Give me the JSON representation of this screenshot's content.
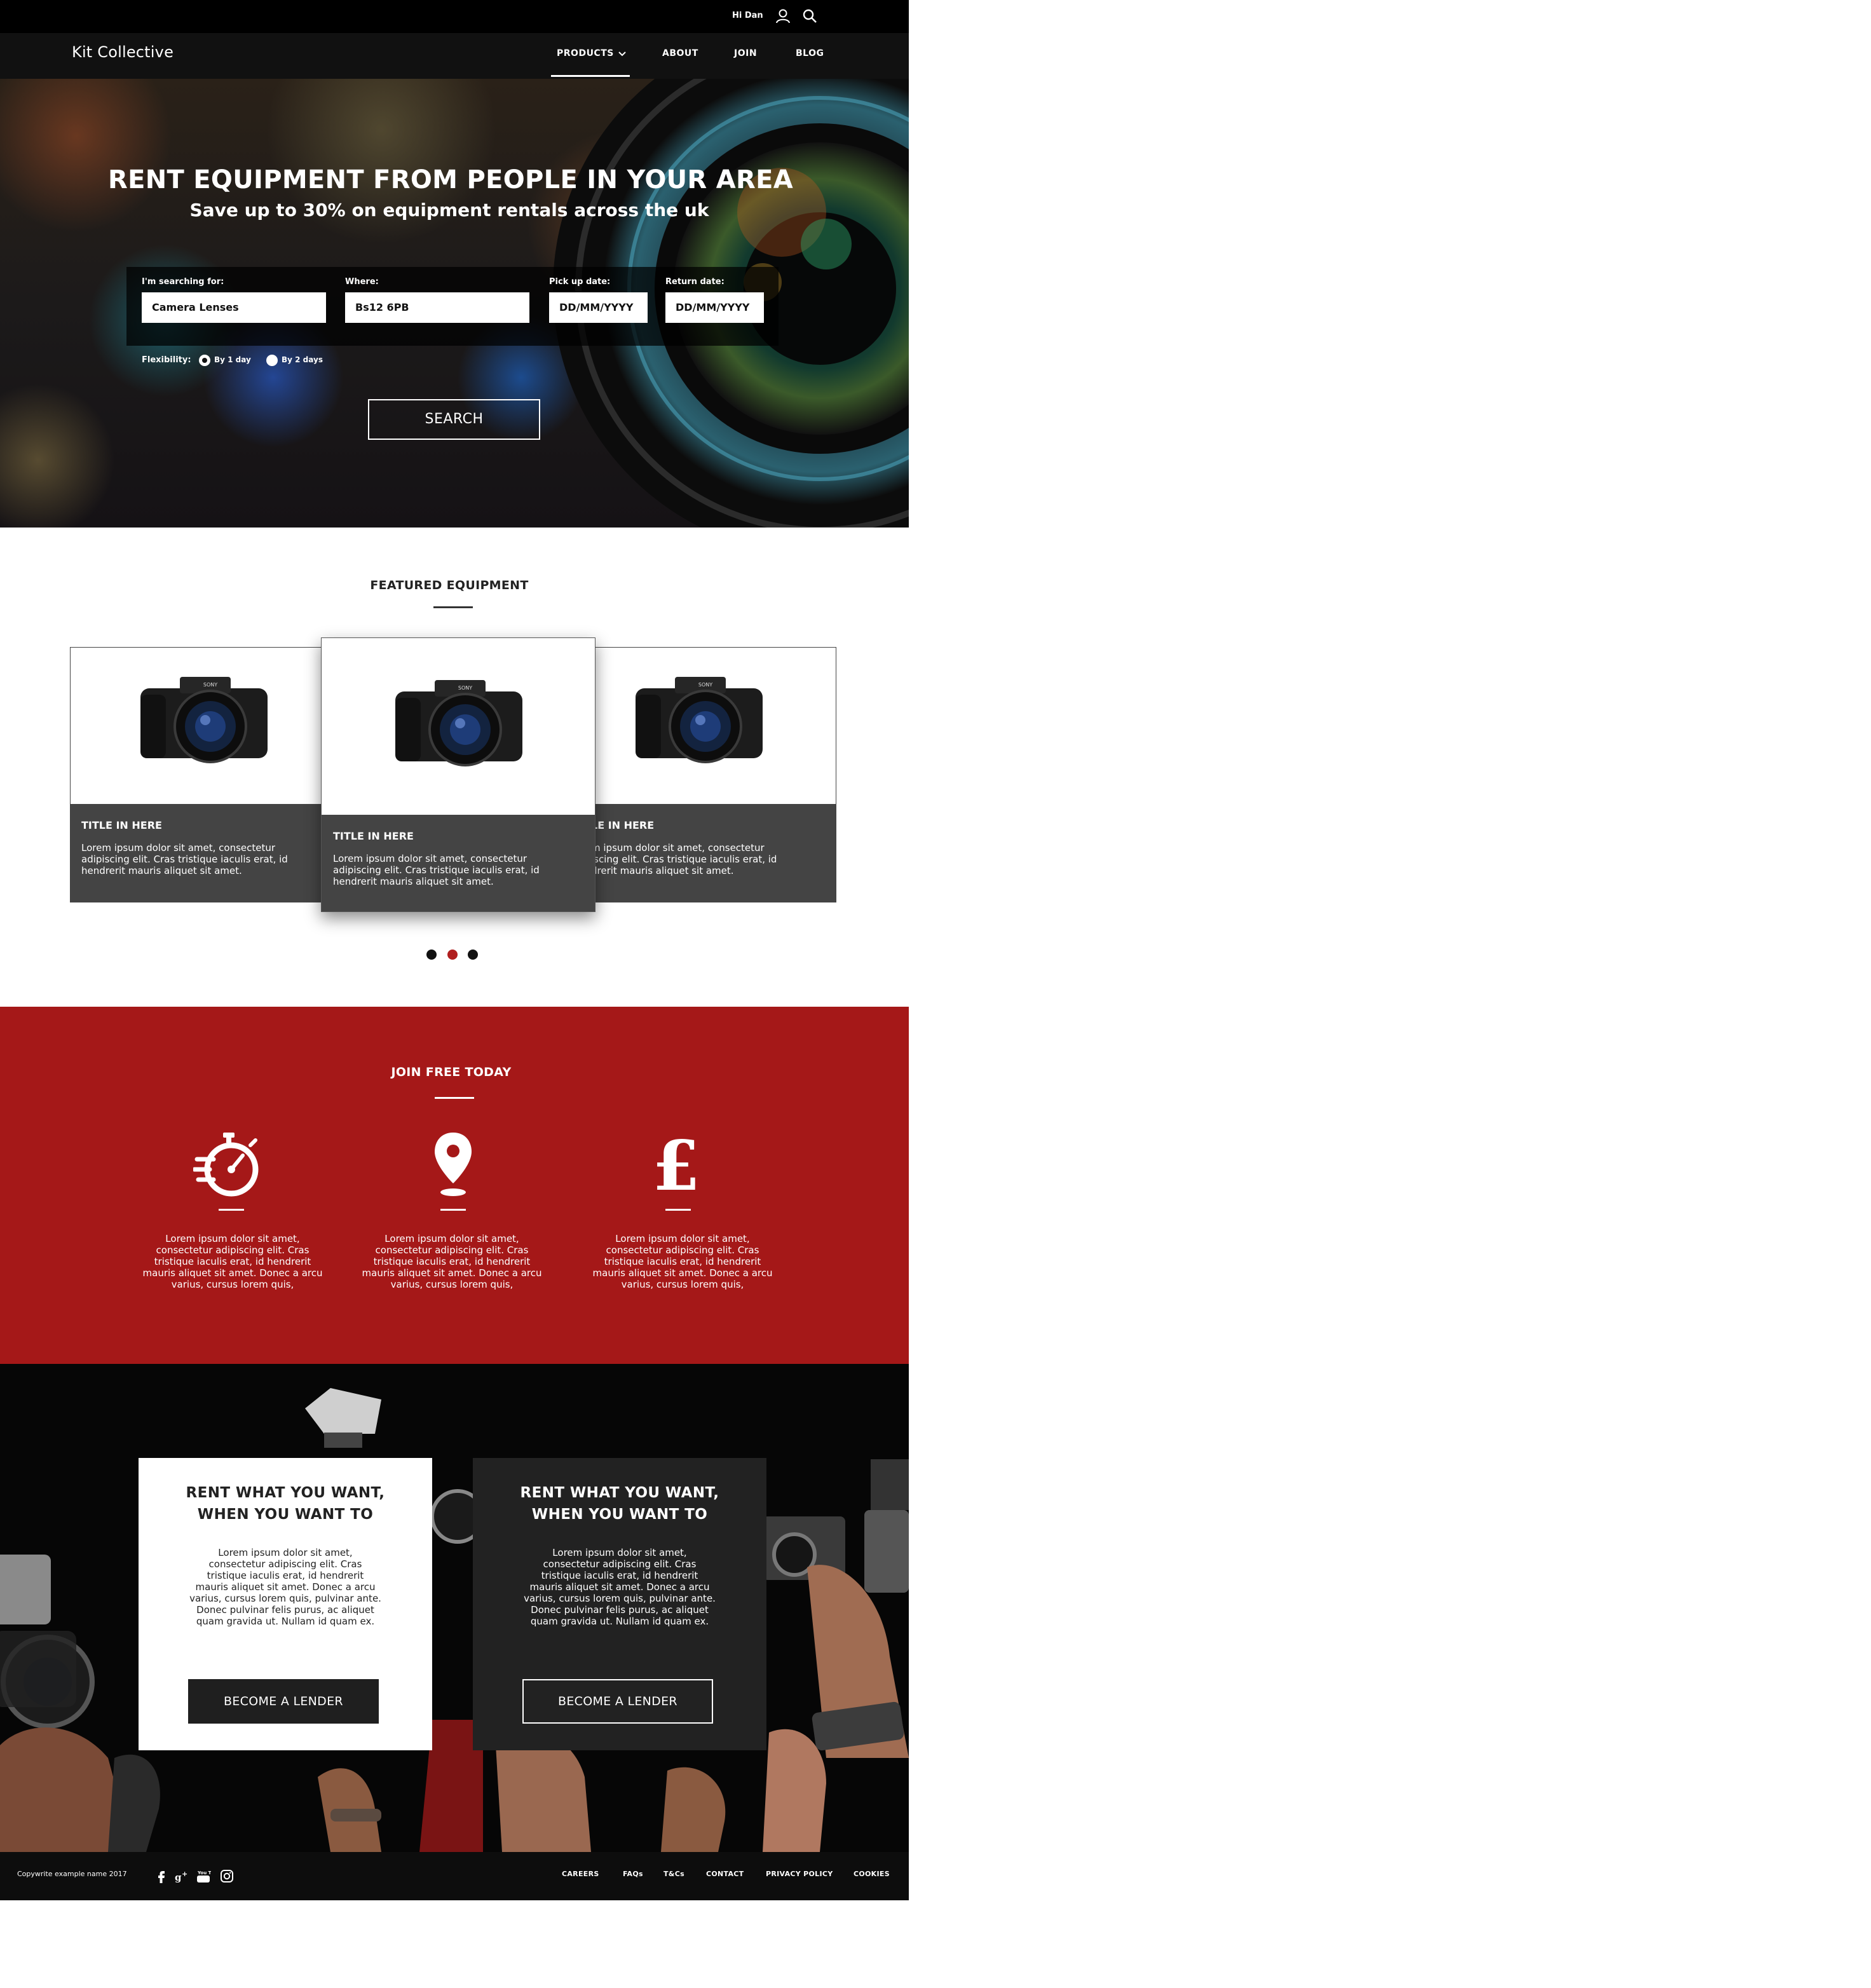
{
  "header": {
    "greeting": "Hi Dan",
    "brand": "Kit Collective",
    "nav": {
      "products": "PRODUCTS",
      "about": "ABOUT",
      "join": "JOIN",
      "blog": "BLOG"
    }
  },
  "hero": {
    "title": "RENT EQUIPMENT FROM PEOPLE IN YOUR AREA",
    "subtitle": "Save up to 30% on equipment rentals across the uk",
    "search": {
      "searching_label": "I'm searching for:",
      "searching_value": "Camera Lenses",
      "where_label": "Where:",
      "where_value": "Bs12 6PB",
      "pickup_label": "Pick up date:",
      "pickup_value": "DD/MM/YYYY",
      "return_label": "Return date:",
      "return_value": "DD/MM/YYYY"
    },
    "flexibility": {
      "label": "Flexibility:",
      "option1": "By 1 day",
      "option2": "By 2 days",
      "selected": "By 1 day"
    },
    "search_button": "SEARCH"
  },
  "featured": {
    "title": "FEATURED EQUIPMENT",
    "cards": [
      {
        "title": "TITLE IN HERE",
        "text": "Lorem ipsum dolor sit amet, consectetur adipiscing elit. Cras tristique iaculis erat, id hendrerit mauris aliquet sit amet.",
        "brand": "SONY"
      },
      {
        "title": "TITLE IN HERE",
        "text": "Lorem ipsum dolor sit amet, consectetur adipiscing elit. Cras tristique iaculis erat, id hendrerit mauris aliquet sit amet.",
        "brand": "SONY"
      },
      {
        "title": "LE IN HERE",
        "text": "m ipsum dolor sit amet, consectetur iscing elit. Cras tristique iaculis erat, id drerit mauris aliquet sit amet.",
        "brand": "SONY"
      }
    ],
    "active_slide": 2,
    "slide_count": 3
  },
  "join": {
    "title": "JOIN FREE TODAY",
    "features": [
      {
        "icon": "stopwatch-icon",
        "text": "Lorem ipsum dolor sit amet, consectetur adipiscing elit. Cras tristique iaculis erat, id hendrerit mauris aliquet sit amet. Donec a arcu varius, cursus lorem quis,"
      },
      {
        "icon": "map-pin-icon",
        "text": "Lorem ipsum dolor sit amet, consectetur adipiscing elit. Cras tristique iaculis erat, id hendrerit mauris aliquet sit amet. Donec a arcu varius, cursus lorem quis,"
      },
      {
        "icon": "pound-sign-icon",
        "text": "Lorem ipsum dolor sit amet, consectetur adipiscing elit. Cras tristique iaculis erat, id hendrerit mauris aliquet sit amet. Donec a arcu varius, cursus lorem quis,"
      }
    ]
  },
  "lender": {
    "boxes": [
      {
        "title_line1": "RENT WHAT YOU WANT,",
        "title_line2": "WHEN YOU WANT TO",
        "text": "Lorem ipsum dolor sit amet, consectetur adipiscing elit. Cras tristique iaculis erat, id hendrerit mauris aliquet sit amet. Donec a arcu varius, cursus lorem quis, pulvinar ante. Donec pulvinar felis purus, ac aliquet quam gravida ut. Nullam id quam ex.",
        "button": "BECOME A LENDER"
      },
      {
        "title_line1": "RENT WHAT YOU WANT,",
        "title_line2": "WHEN YOU WANT TO",
        "text": "Lorem ipsum dolor sit amet, consectetur adipiscing elit. Cras tristique iaculis erat, id hendrerit mauris aliquet sit amet. Donec a arcu varius, cursus lorem quis, pulvinar ante. Donec pulvinar felis purus, ac aliquet quam gravida ut. Nullam id quam ex.",
        "button": "BECOME A LENDER"
      }
    ]
  },
  "footer": {
    "copyright": "Copywrite example name 2017",
    "social": [
      "facebook-icon",
      "google-plus-icon",
      "youtube-icon",
      "instagram-icon"
    ],
    "youtube_label": "You Tube",
    "links": {
      "careers": "CAREERS",
      "faqs": "FAQs",
      "tcs": "T&Cs",
      "contact": "CONTACT",
      "privacy": "PRIVACY POLICY",
      "cookies": "COOKIES"
    }
  },
  "colors": {
    "accent_red": "#a51818",
    "dark": "#111111",
    "card_body": "#444444"
  }
}
